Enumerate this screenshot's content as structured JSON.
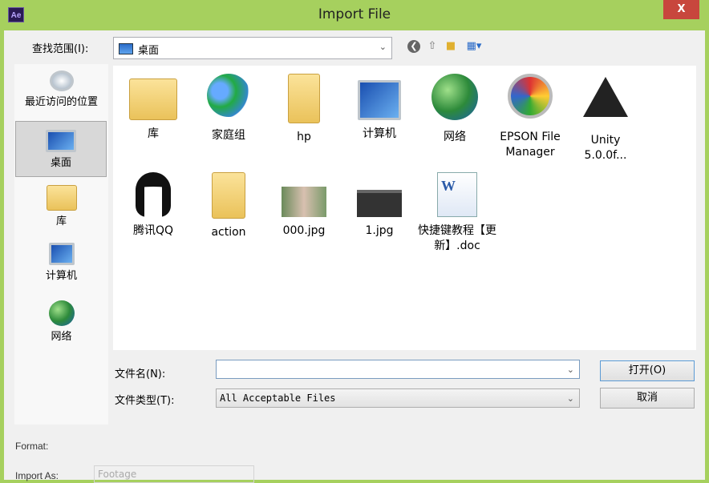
{
  "window": {
    "title": "Import File",
    "app_icon": "Ae",
    "close_label": "X"
  },
  "look_in": {
    "label": "查找范围(I):",
    "value": "桌面"
  },
  "toolbar": {
    "icons": [
      "back-icon",
      "up-folder-icon",
      "new-folder-icon",
      "view-menu-icon"
    ]
  },
  "places": [
    {
      "label": "最近访问的位置",
      "icon": "recent-places-icon"
    },
    {
      "label": "桌面",
      "icon": "desktop-icon",
      "selected": true
    },
    {
      "label": "库",
      "icon": "libraries-icon"
    },
    {
      "label": "计算机",
      "icon": "computer-icon"
    },
    {
      "label": "网络",
      "icon": "network-icon"
    }
  ],
  "files": [
    {
      "label": "库",
      "icon": "libraries-icon"
    },
    {
      "label": "家庭组",
      "icon": "homegroup-icon"
    },
    {
      "label": "hp",
      "icon": "user-folder-icon"
    },
    {
      "label": "计算机",
      "icon": "computer-icon"
    },
    {
      "label": "网络",
      "icon": "network-icon"
    },
    {
      "label": "EPSON File Manager",
      "icon": "epson-icon"
    },
    {
      "label": "Unity 5.0.0f...",
      "icon": "unity-icon"
    },
    {
      "label": "腾讯QQ",
      "icon": "qq-icon"
    },
    {
      "label": "action",
      "icon": "folder-icon"
    },
    {
      "label": "000.jpg",
      "icon": "image-thumbnail-icon"
    },
    {
      "label": "1.jpg",
      "icon": "image-thumbnail-icon"
    },
    {
      "label": "快捷键教程【更新】.doc",
      "icon": "word-doc-icon"
    }
  ],
  "filename": {
    "label": "文件名(N):",
    "value": ""
  },
  "filetype": {
    "label": "文件类型(T):",
    "value": "All Acceptable Files"
  },
  "buttons": {
    "open": "打开(O)",
    "cancel": "取消"
  },
  "format": {
    "label": "Format:"
  },
  "import_as": {
    "label": "Import As:",
    "value": "Footage"
  },
  "colors": {
    "titlebar": "#a6d05e",
    "close": "#c8463d",
    "selection": "#d8d8d8"
  }
}
